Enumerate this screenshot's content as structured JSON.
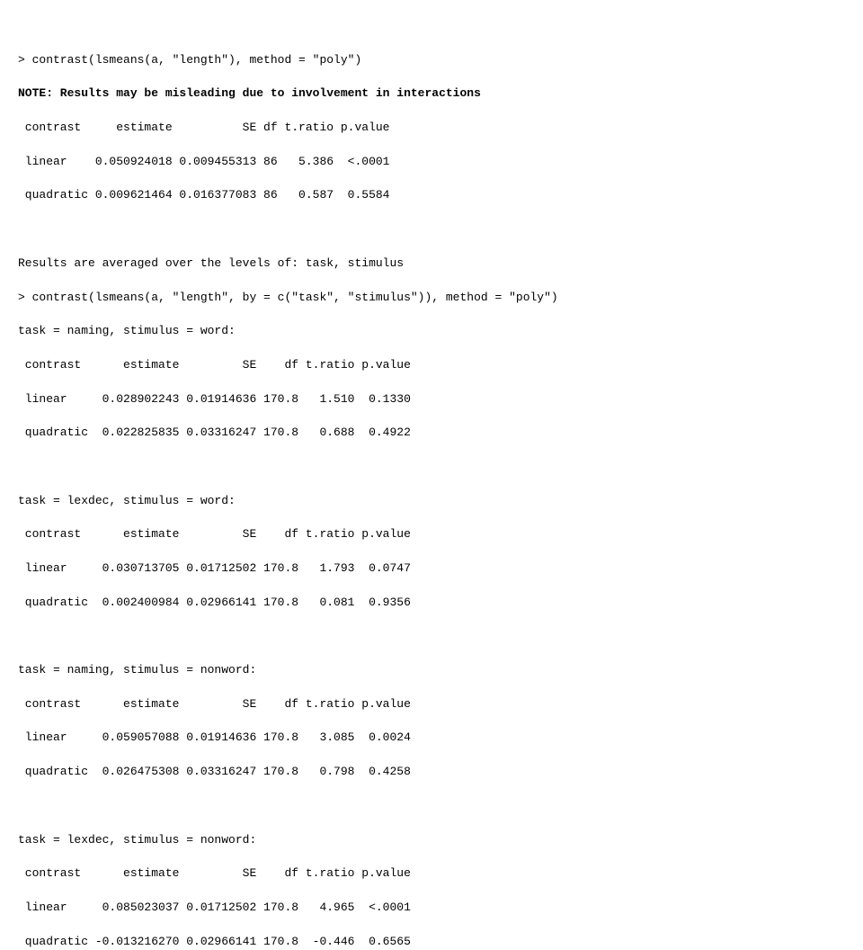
{
  "l1": "> contrast(lsmeans(a, \"length\"), method = \"poly\")",
  "l2": "NOTE: Results may be misleading due to involvement in interactions",
  "l3": " contrast     estimate          SE df t.ratio p.value",
  "l4": " linear    0.050924018 0.009455313 86   5.386  <.0001",
  "l5": " quadratic 0.009621464 0.016377083 86   0.587  0.5584",
  "l6": "",
  "l7": "Results are averaged over the levels of: task, stimulus",
  "l8": "> contrast(lsmeans(a, \"length\", by = c(\"task\", \"stimulus\")), method = \"poly\")",
  "l9": "task = naming, stimulus = word:",
  "l10": " contrast      estimate         SE    df t.ratio p.value",
  "l11": " linear     0.028902243 0.01914636 170.8   1.510  0.1330",
  "l12": " quadratic  0.022825835 0.03316247 170.8   0.688  0.4922",
  "l13": "",
  "l14": "task = lexdec, stimulus = word:",
  "l15": " contrast      estimate         SE    df t.ratio p.value",
  "l16": " linear     0.030713705 0.01712502 170.8   1.793  0.0747",
  "l17": " quadratic  0.002400984 0.02966141 170.8   0.081  0.9356",
  "l18": "",
  "l19": "task = naming, stimulus = nonword:",
  "l20": " contrast      estimate         SE    df t.ratio p.value",
  "l21": " linear     0.059057088 0.01914636 170.8   3.085  0.0024",
  "l22": " quadratic  0.026475308 0.03316247 170.8   0.798  0.4258",
  "l23": "",
  "l24": "task = lexdec, stimulus = nonword:",
  "l25": " contrast      estimate         SE    df t.ratio p.value",
  "l26": " linear     0.085023037 0.01712502 170.8   4.965  <.0001",
  "l27": " quadratic -0.013216270 0.02966141 170.8  -0.446  0.6565"
}
